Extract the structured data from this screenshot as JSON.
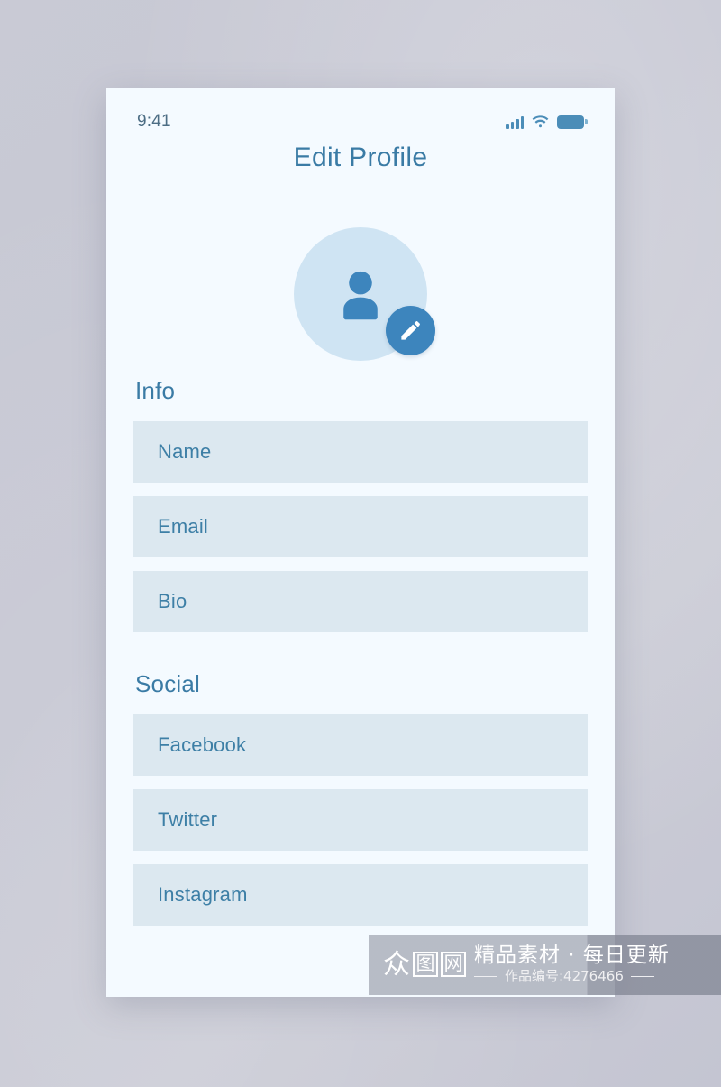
{
  "background": {
    "color": "#c8c9d4"
  },
  "phone": {
    "background": "#f4faff",
    "status_bar": {
      "time": "9:41",
      "signal_icon": "signal-bars-icon",
      "wifi_icon": "wifi-icon",
      "battery_icon": "battery-icon"
    },
    "title": "Edit Profile",
    "accent_color": "#3a7ba5",
    "avatar": {
      "circle_color": "#cfe4f3",
      "person_icon": "person-icon",
      "edit_badge": {
        "icon": "pencil-icon",
        "color": "#3d85bd"
      }
    },
    "sections": [
      {
        "title": "Info",
        "fields": [
          {
            "label": "Name",
            "value": "",
            "placeholder": "Name"
          },
          {
            "label": "Email",
            "value": "",
            "placeholder": "Email"
          },
          {
            "label": "Bio",
            "value": "",
            "placeholder": "Bio"
          }
        ]
      },
      {
        "title": "Social",
        "fields": [
          {
            "label": "Facebook",
            "value": "",
            "placeholder": "Facebook"
          },
          {
            "label": "Twitter",
            "value": "",
            "placeholder": "Twitter"
          },
          {
            "label": "Instagram",
            "value": "",
            "placeholder": "Instagram"
          }
        ]
      }
    ],
    "field_background": "#dce8f0",
    "field_label_color": "#3d7fa6"
  },
  "watermark": {
    "logo_chars": [
      "众",
      "图",
      "网"
    ],
    "tagline": "精品素材 · 每日更新",
    "item_number": "作品编号:4276466"
  }
}
